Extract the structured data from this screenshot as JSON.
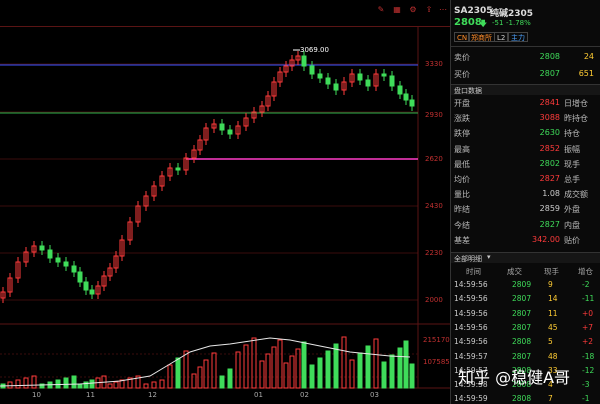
{
  "toolbar": {
    "icons": [
      "edit-icon",
      "grid-icon",
      "settings-icon",
      "share-icon",
      "more-icon"
    ]
  },
  "chart": {
    "price_ticks": [
      "3330",
      "3069.00",
      "2930",
      "2620",
      "2430",
      "2230",
      "2000"
    ],
    "high_label": "3069.00",
    "volume_labels": [
      "215170",
      "107585"
    ],
    "date_labels": [
      "10",
      "11",
      "12",
      "01",
      "02",
      "03"
    ],
    "colors": {
      "up": "#ff3b3b",
      "down": "#3fdc5a",
      "blue_line": "#3a55ff",
      "green_line": "#2bb24c",
      "magenta_line": "#ff3cc8",
      "volume_line": "#e8e8e8"
    }
  },
  "header": {
    "code": "SA2305",
    "name": "纯碱2305",
    "price": "2808",
    "change": "-51",
    "change_pct": "-1.78%",
    "tags": [
      "CN",
      "郑商所",
      "L2",
      "主力"
    ]
  },
  "quote": {
    "sell_label": "卖价",
    "sell_price": "2808",
    "sell_vol": "24",
    "buy_label": "买价",
    "buy_price": "2807",
    "buy_vol": "651"
  },
  "panel_title": "盘口数据",
  "stats": [
    {
      "label": "开盘",
      "value": "2841",
      "label2": "日增仓"
    },
    {
      "label": "涨跌",
      "value": "3088",
      "label2": "昨持仓"
    },
    {
      "label": "跌停",
      "value": "2630",
      "label2": "持仓"
    },
    {
      "label": "最高",
      "value": "2852",
      "label2": "振幅"
    },
    {
      "label": "最低",
      "value": "2802",
      "label2": "现手"
    },
    {
      "label": "均价",
      "value": "2827",
      "label2": "总手"
    },
    {
      "label": "量比",
      "value": "1.08",
      "label2": "成交额"
    },
    {
      "label": "昨结",
      "value": "2859",
      "label2": "外盘"
    },
    {
      "label": "今结",
      "value": "2827",
      "label2": "内盘"
    },
    {
      "label": "基差",
      "value": "342.00",
      "label2": "贴价"
    }
  ],
  "trades_title": "全部明细",
  "trades_headers": [
    "时间",
    "成交",
    "现手",
    "增仓"
  ],
  "trades": [
    {
      "time": "14:59:56",
      "price": "2809",
      "vol": "9",
      "delta": "-2"
    },
    {
      "time": "14:59:56",
      "price": "2807",
      "vol": "14",
      "delta": "-11"
    },
    {
      "time": "14:59:56",
      "price": "2807",
      "vol": "11",
      "delta": "+0"
    },
    {
      "time": "14:59:56",
      "price": "2807",
      "vol": "45",
      "delta": "+7"
    },
    {
      "time": "14:59:56",
      "price": "2808",
      "vol": "5",
      "delta": "+2"
    },
    {
      "time": "14:59:57",
      "price": "2807",
      "vol": "48",
      "delta": "-18"
    },
    {
      "time": "14:59:57",
      "price": "2808",
      "vol": "33",
      "delta": "-12"
    },
    {
      "time": "14:59:58",
      "price": "2808",
      "vol": "4",
      "delta": "-3"
    },
    {
      "time": "14:59:59",
      "price": "2808",
      "vol": "7",
      "delta": "-1"
    }
  ],
  "watermark": "知乎 @稳健A哥"
}
